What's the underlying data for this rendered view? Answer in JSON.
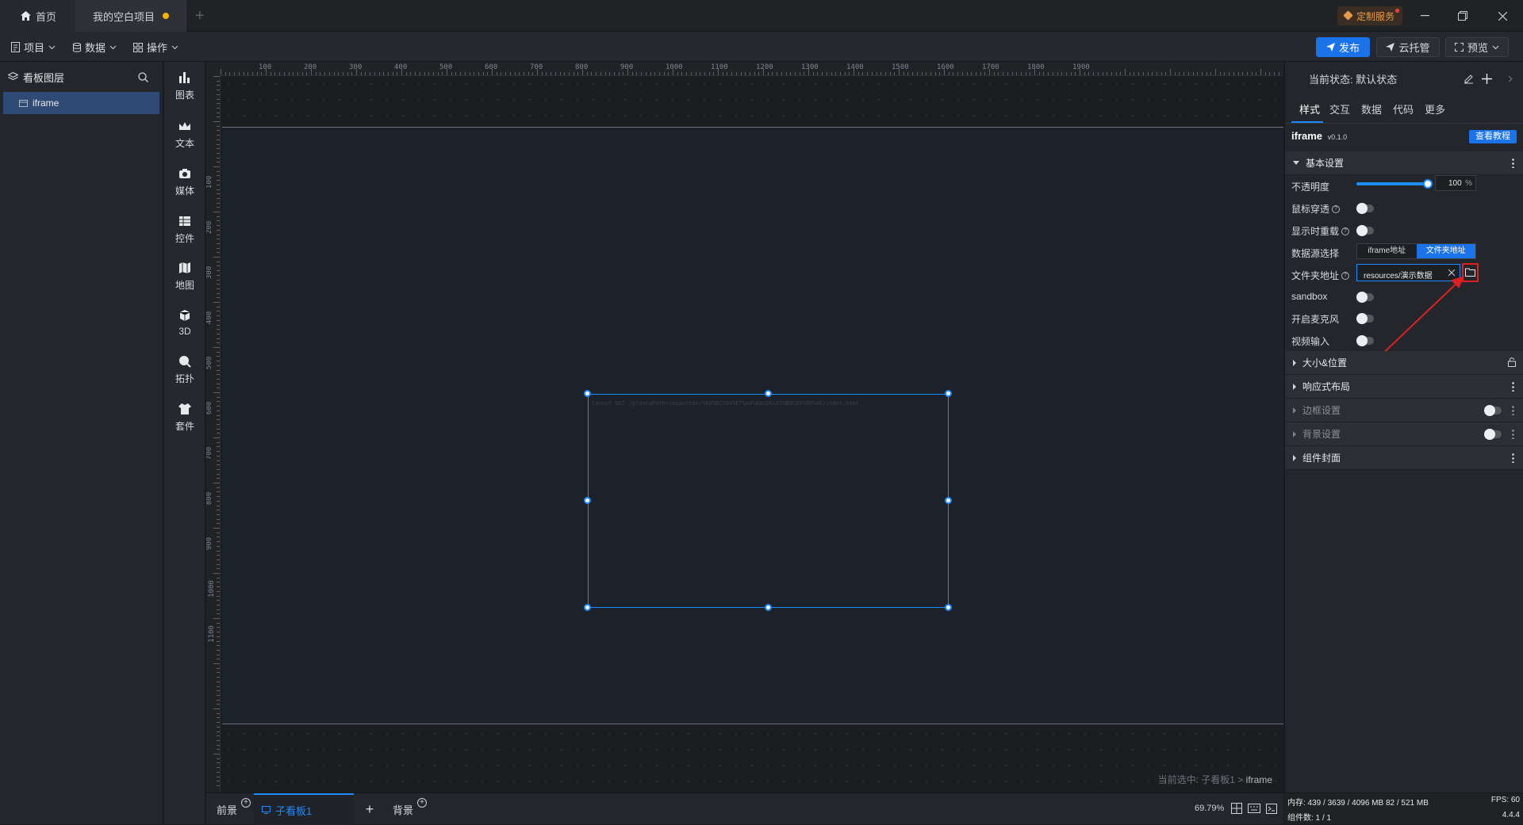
{
  "titlebar": {
    "home_tab": "首页",
    "project_tab": "我的空白项目",
    "custom_service": "定制服务"
  },
  "menubar": {
    "project": "项目",
    "data": "数据",
    "operate": "操作",
    "publish": "发布",
    "cloud_host": "云托管",
    "preview": "预览"
  },
  "layers": {
    "title": "看板图层",
    "items": [
      "iframe"
    ]
  },
  "components": [
    "图表",
    "文本",
    "媒体",
    "控件",
    "地图",
    "3D",
    "拓扑",
    "套件"
  ],
  "rulers": {
    "h": [
      "100",
      "200",
      "300",
      "400",
      "500",
      "600",
      "700",
      "800",
      "900",
      "1000",
      "1100",
      "1200",
      "1300",
      "1400",
      "1500",
      "1600",
      "1700",
      "1800",
      "1900"
    ],
    "v": [
      "100",
      "200",
      "300",
      "400",
      "500",
      "600",
      "700",
      "800",
      "900",
      "1000",
      "1100"
    ]
  },
  "canvas": {
    "iframe_error": "Cannot GET /g?dataPath=resources/%E6%BC%94%E7%A4%BA%E6%95%B0%E6%8D%AE/index.html",
    "crumb_prefix": "当前选中: 子看板1 > ",
    "crumb_item": "iframe"
  },
  "bottombar": {
    "foreground": "前景",
    "subboard": "子看板1",
    "background": "背景",
    "zoom": "69.79%"
  },
  "status": {
    "memory": "内存: 439 / 3639 / 4096 MB  82 / 521 MB",
    "fps": "FPS: 60",
    "components": "组件数: 1 / 1",
    "version": "4.4.4"
  },
  "panel": {
    "state": "当前状态: 默认状态",
    "tabs": [
      "样式",
      "交互",
      "数据",
      "代码",
      "更多"
    ],
    "component_name": "iframe",
    "component_version": "v0.1.0",
    "tutorial": "查看教程",
    "sections": {
      "basic": "基本设置",
      "size": "大小&位置",
      "responsive": "响应式布局",
      "border": "边框设置",
      "bg": "背景设置",
      "cover": "组件封面"
    },
    "opacity_label": "不透明度",
    "opacity_value": "100",
    "opacity_unit": "%",
    "opacity_fraction": 1.0,
    "mouse_through": "鼠标穿透",
    "reload_on_show": "显示时重载",
    "datasource_label": "数据源选择",
    "datasource_options": [
      "iframe地址",
      "文件夹地址"
    ],
    "folder_label": "文件夹地址",
    "folder_value": "resources/演示数据",
    "sandbox": "sandbox",
    "microphone": "开启麦克风",
    "video_input": "视频输入"
  },
  "accent": "#1e8bff",
  "highlight": "#e02020"
}
